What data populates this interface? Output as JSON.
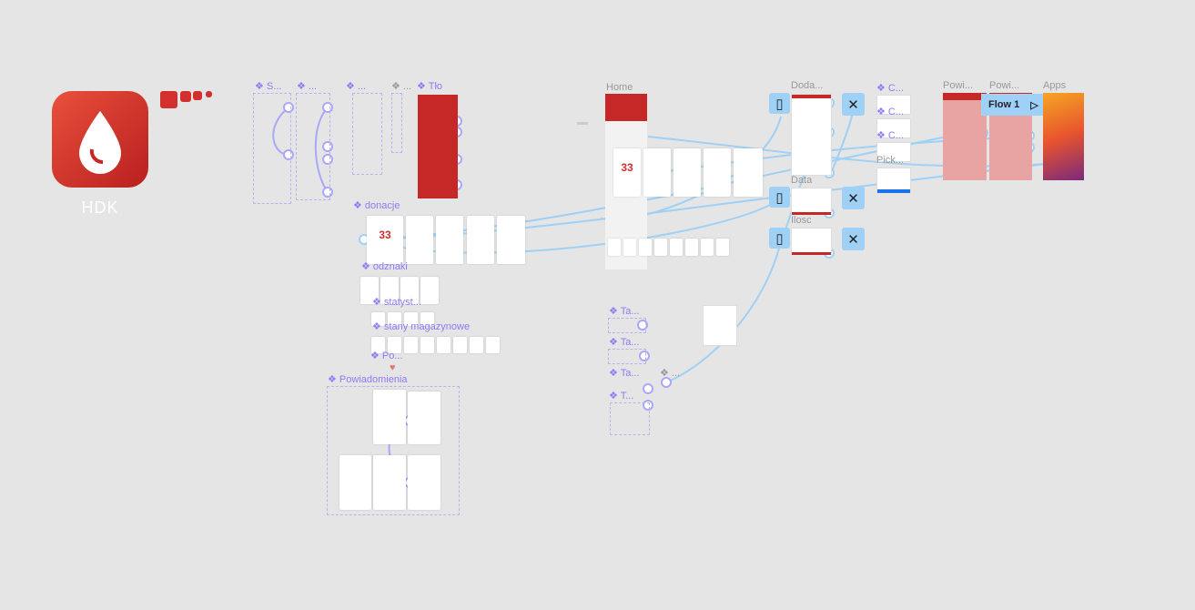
{
  "app": {
    "name": "HDK",
    "brand_color": "#d32f2f",
    "accent_color": "#8b7cf6",
    "prototype_color": "#9fd0f5"
  },
  "components": {
    "s": "S...",
    "c2": "...",
    "c3": "...",
    "c4": "...",
    "c5": "...",
    "tlo": "Tło",
    "donacje": "donacje",
    "odznaki": "odznaki",
    "statyst": "statyst...",
    "stany": "stany magazynowe",
    "po": "Po...",
    "powiadomienia": "Powiadomienia",
    "ta1": "Ta...",
    "ta2": "Ta...",
    "ta3": "Ta...",
    "t4": "T...",
    "dots": "...",
    "c_a": "C...",
    "c_b": "C...",
    "c_c": "C..."
  },
  "frames": {
    "home": "Home",
    "doda": "Doda...",
    "data": "Data",
    "ilosc": "Ilosc",
    "pick": "Pick...",
    "powi1": "Powi...",
    "powi2": "Powi...",
    "apps": "Apps"
  },
  "donation_counter": "33",
  "flow": {
    "label": "Flow 1",
    "icon": "play-icon"
  },
  "icons": {
    "device": "device-icon",
    "close": "close-icon",
    "component": "component-icon"
  }
}
